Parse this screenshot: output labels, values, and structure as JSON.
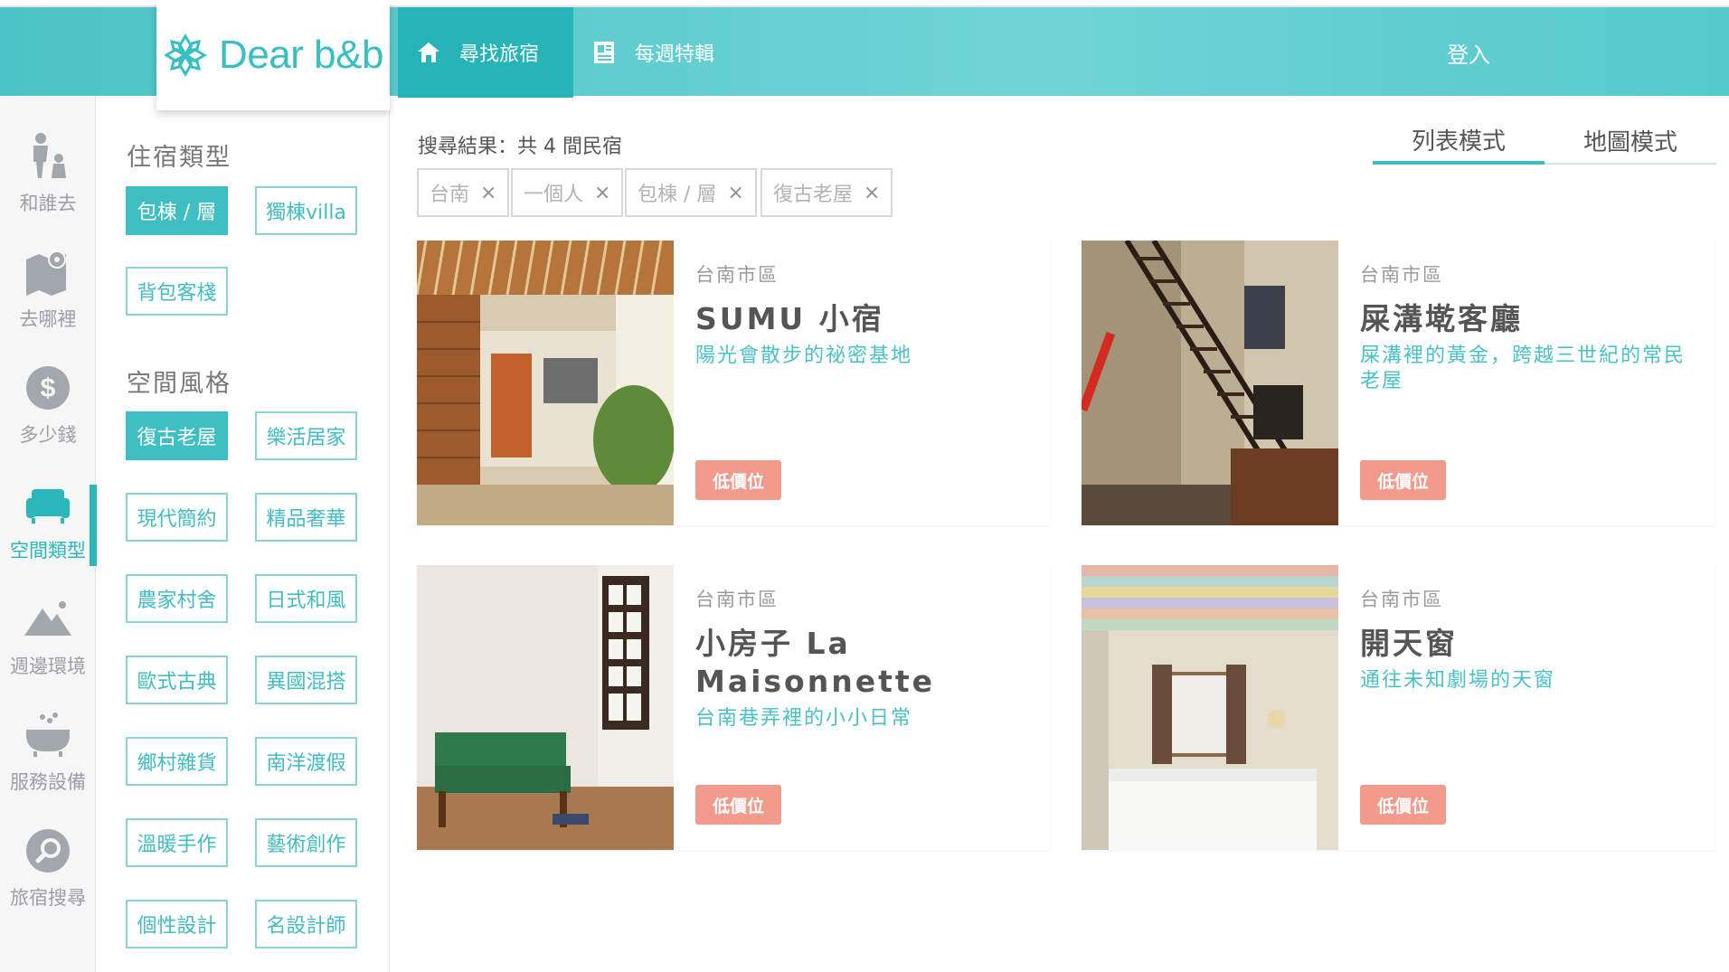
{
  "header": {
    "logo_text": "Dear b&b",
    "nav": [
      {
        "label": "尋找旅宿",
        "icon": "home-icon"
      },
      {
        "label": "每週特輯",
        "icon": "newspaper-icon"
      }
    ],
    "login_label": "登入"
  },
  "rail": [
    {
      "label": "和誰去",
      "icon": "people-icon"
    },
    {
      "label": "去哪裡",
      "icon": "map-icon"
    },
    {
      "label": "多少錢",
      "icon": "dollar-icon"
    },
    {
      "label": "空間類型",
      "icon": "sofa-icon",
      "active": true
    },
    {
      "label": "週邊環境",
      "icon": "mountain-icon"
    },
    {
      "label": "服務設備",
      "icon": "bathtub-icon"
    },
    {
      "label": "旅宿搜尋",
      "icon": "search-icon"
    }
  ],
  "filters": {
    "lodging_heading": "住宿類型",
    "lodging": [
      {
        "label": "包棟 / 層",
        "selected": true
      },
      {
        "label": "獨棟villa",
        "selected": false
      },
      {
        "label": "背包客棧",
        "selected": false
      }
    ],
    "style_heading": "空間風格",
    "styles": [
      {
        "label": "復古老屋",
        "selected": true
      },
      {
        "label": "樂活居家",
        "selected": false
      },
      {
        "label": "現代簡約",
        "selected": false
      },
      {
        "label": "精品奢華",
        "selected": false
      },
      {
        "label": "農家村舍",
        "selected": false
      },
      {
        "label": "日式和風",
        "selected": false
      },
      {
        "label": "歐式古典",
        "selected": false
      },
      {
        "label": "異國混搭",
        "selected": false
      },
      {
        "label": "鄉村雜貨",
        "selected": false
      },
      {
        "label": "南洋渡假",
        "selected": false
      },
      {
        "label": "溫暖手作",
        "selected": false
      },
      {
        "label": "藝術創作",
        "selected": false
      },
      {
        "label": "個性設計",
        "selected": false
      },
      {
        "label": "名設計師",
        "selected": false
      }
    ]
  },
  "results": {
    "summary": "搜尋結果：共 4 間民宿",
    "view_tabs": [
      "列表模式",
      "地圖模式"
    ],
    "active_tags": [
      "台南",
      "一個人",
      "包棟 / 層",
      "復古老屋"
    ],
    "remove_glyph": "×"
  },
  "listings": [
    {
      "region": "台南市區",
      "name": "SUMU 小宿",
      "tagline": "陽光會散步的祕密基地",
      "price_badge": "低價位"
    },
    {
      "region": "台南市區",
      "name": "屎溝墘客廳",
      "tagline": "屎溝裡的黃金，跨越三世紀的常民老屋",
      "price_badge": "低價位"
    },
    {
      "region": "台南市區",
      "name": "小房子 La Maisonnette",
      "tagline": "台南巷弄裡的小小日常",
      "price_badge": "低價位"
    },
    {
      "region": "台南市區",
      "name": "開天窗",
      "tagline": "通往未知劇場的天窗",
      "price_badge": "低價位"
    }
  ],
  "colors": {
    "accent": "#3fbfc2",
    "price": "#f29a8c",
    "rail_bg": "#f6f6f6"
  }
}
